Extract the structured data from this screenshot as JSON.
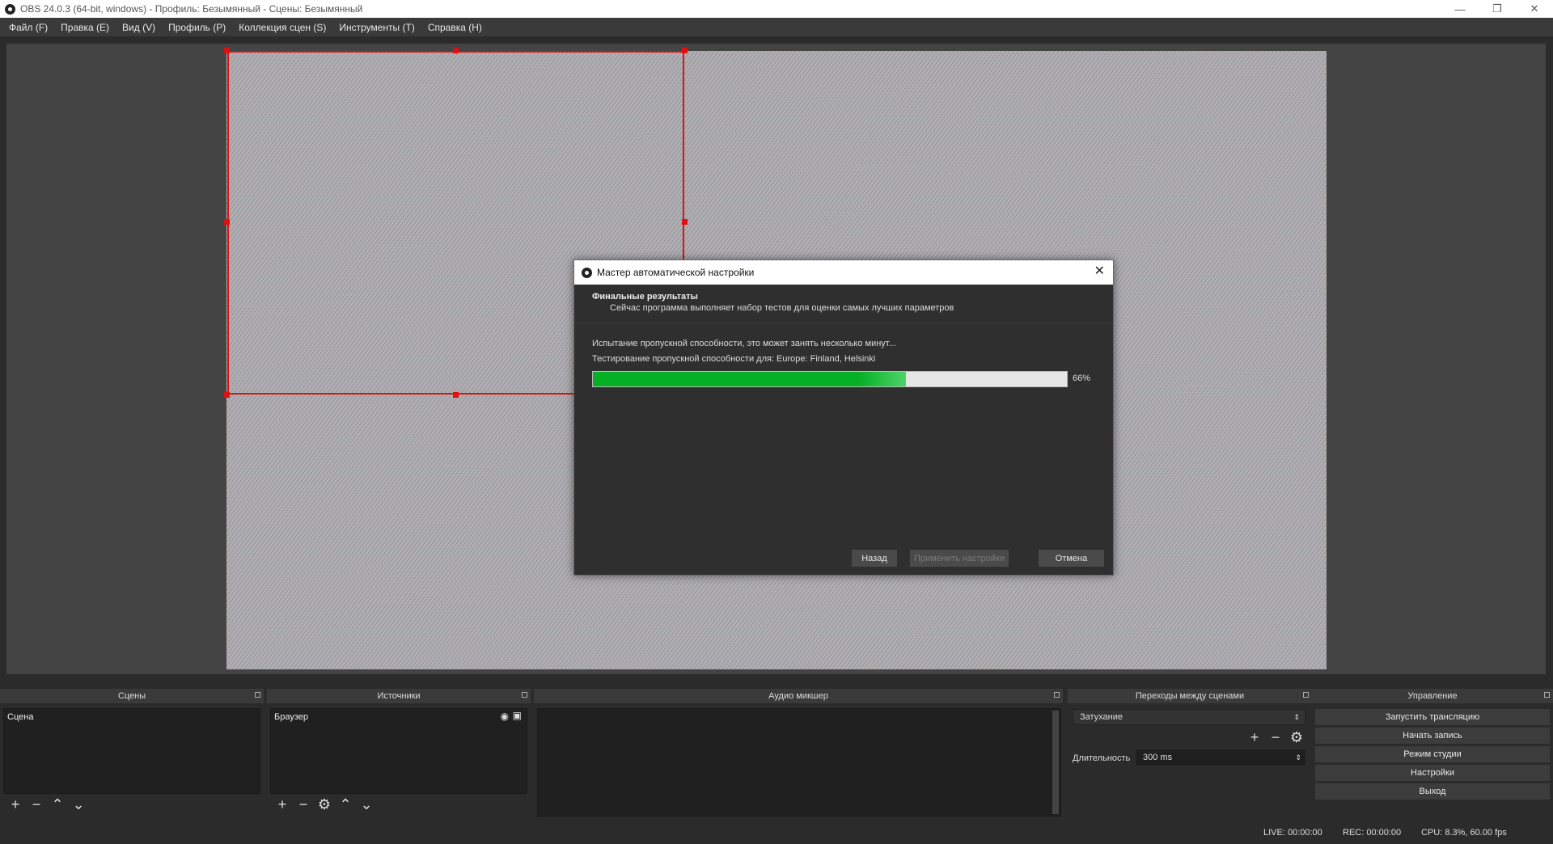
{
  "window": {
    "title": "OBS 24.0.3 (64-bit, windows) - Профиль: Безымянный - Сцены: Безымянный",
    "minimize_icon": "minimize-icon",
    "maximize_icon": "restore-icon",
    "close_icon": "close-icon"
  },
  "menu": [
    "Файл (F)",
    "Правка (E)",
    "Вид (V)",
    "Профиль (P)",
    "Коллекция сцен (S)",
    "Инструменты (T)",
    "Справка (H)"
  ],
  "dialog": {
    "title": "Мастер автоматической настройки",
    "heading": "Финальные результаты",
    "subheading": "Сейчас программа выполняет набор тестов для оценки самых лучших параметров",
    "status_line1": "Испытание пропускной способности, это может занять несколько минут...",
    "status_line2": "Тестирование пропускной способности для: Europe: Finland, Helsinki",
    "progress": 0.66,
    "progress_label": "66%",
    "buttons": {
      "back": "Назад",
      "apply": "Применить настройки",
      "cancel": "Отмена"
    }
  },
  "docks": {
    "scenes": {
      "title": "Сцены",
      "items": [
        "Сцена"
      ]
    },
    "sources": {
      "title": "Источники",
      "items": [
        "Браузер"
      ]
    },
    "mixer": {
      "title": "Аудио микшер"
    },
    "transitions": {
      "title": "Переходы между сценами",
      "selected": "Затухание",
      "duration_label": "Длительность",
      "duration_value": "300 ms"
    },
    "controls": {
      "title": "Управление",
      "buttons": [
        "Запустить трансляцию",
        "Начать запись",
        "Режим студии",
        "Настройки",
        "Выход"
      ]
    }
  },
  "status": {
    "live": "LIVE: 00:00:00",
    "rec": "REC: 00:00:00",
    "cpu": "CPU: 8.3%, 60.00 fps"
  },
  "colors": {
    "selection": "#e01010",
    "progress_fill": "#06b025"
  }
}
